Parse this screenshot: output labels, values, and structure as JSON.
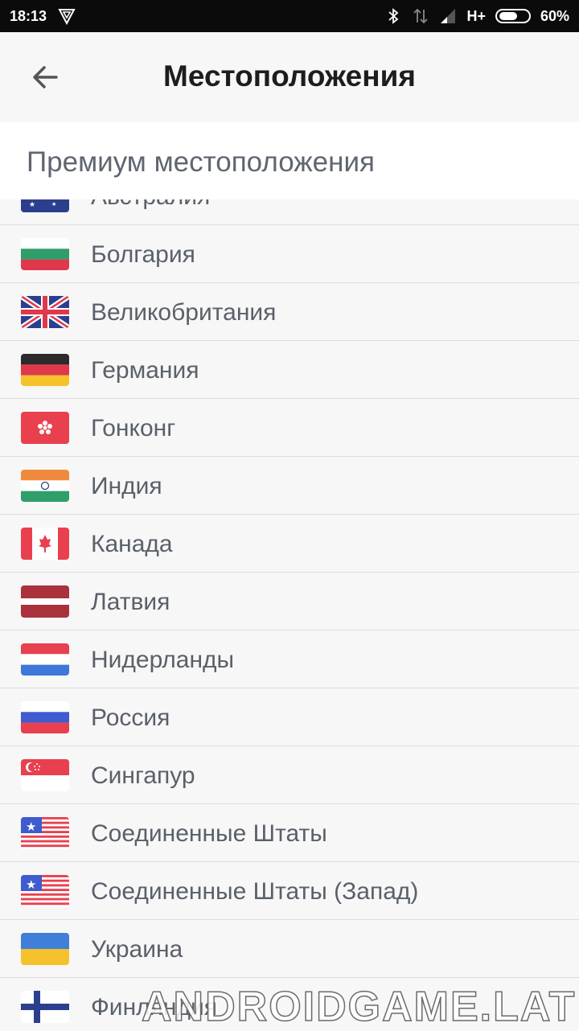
{
  "status_bar": {
    "time": "18:13",
    "network": "H+",
    "battery": "60%"
  },
  "header": {
    "title": "Местоположения"
  },
  "section": {
    "title": "Премиум местоположения"
  },
  "locations": [
    {
      "label": "Австралия",
      "flag": "au"
    },
    {
      "label": "Болгария",
      "flag": "bg"
    },
    {
      "label": "Великобритания",
      "flag": "gb"
    },
    {
      "label": "Германия",
      "flag": "de"
    },
    {
      "label": "Гонконг",
      "flag": "hk"
    },
    {
      "label": "Индия",
      "flag": "in"
    },
    {
      "label": "Канада",
      "flag": "ca"
    },
    {
      "label": "Латвия",
      "flag": "lv"
    },
    {
      "label": "Нидерланды",
      "flag": "nl"
    },
    {
      "label": "Россия",
      "flag": "ru"
    },
    {
      "label": "Сингапур",
      "flag": "sg"
    },
    {
      "label": "Соединенные Штаты",
      "flag": "us"
    },
    {
      "label": "Соединенные Штаты (Запад)",
      "flag": "us"
    },
    {
      "label": "Украина",
      "flag": "ua"
    },
    {
      "label": "Финляндия",
      "flag": "fi"
    }
  ],
  "watermark": "ANDROIDGAME.LAT"
}
